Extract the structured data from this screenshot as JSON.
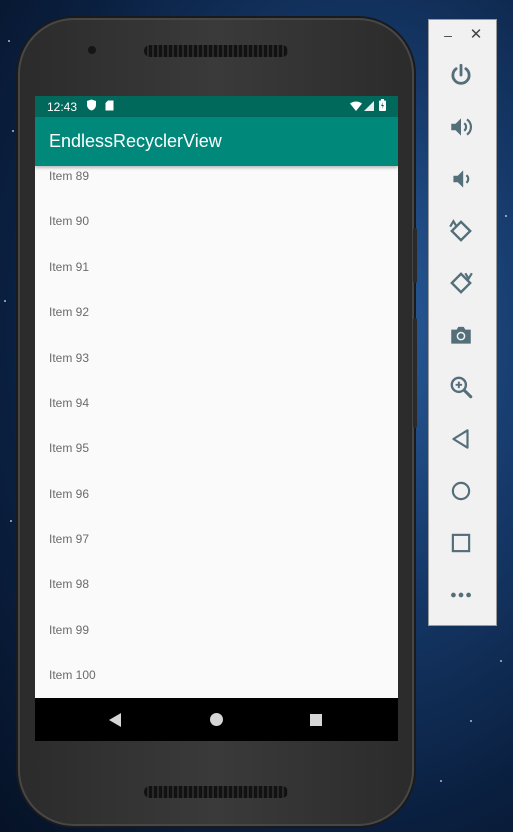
{
  "statusbar": {
    "time": "12:43"
  },
  "app": {
    "title": "EndlessRecyclerView"
  },
  "list": {
    "items": [
      "Item 89",
      "Item 90",
      "Item 91",
      "Item 92",
      "Item 93",
      "Item 94",
      "Item 95",
      "Item 96",
      "Item 97",
      "Item 98",
      "Item 99",
      "Item 100"
    ]
  },
  "emulator_panel": {
    "controls": [
      "power-icon",
      "volume-up-icon",
      "volume-down-icon",
      "rotate-left-icon",
      "rotate-right-icon",
      "camera-icon",
      "zoom-icon",
      "back-icon",
      "home-icon",
      "overview-icon",
      "more-icon"
    ]
  },
  "colors": {
    "primary": "#00897b",
    "primary_dark": "#00695c",
    "list_bg": "#fafafa",
    "panel_icon": "#546e7a"
  }
}
